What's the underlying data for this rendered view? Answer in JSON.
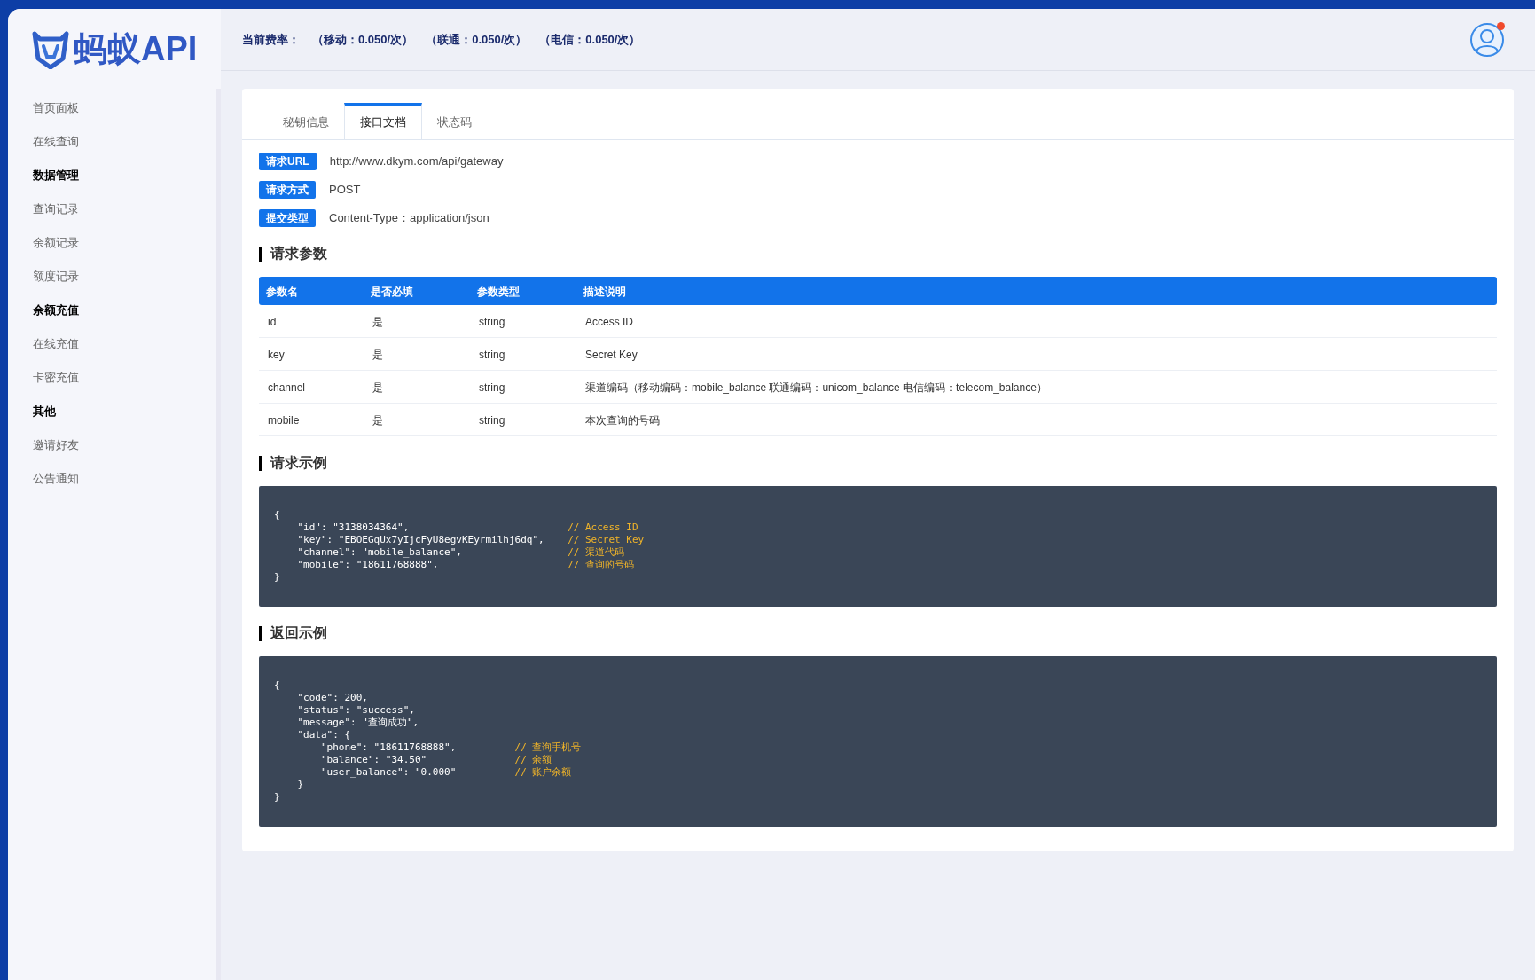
{
  "brand": {
    "name": "蚂蚁API"
  },
  "sidebar": [
    {
      "kind": "link",
      "label": "首页面板"
    },
    {
      "kind": "link",
      "label": "在线查询"
    },
    {
      "kind": "header",
      "label": "数据管理"
    },
    {
      "kind": "link",
      "label": "查询记录"
    },
    {
      "kind": "link",
      "label": "余额记录"
    },
    {
      "kind": "link",
      "label": "额度记录"
    },
    {
      "kind": "header",
      "label": "余额充值"
    },
    {
      "kind": "link",
      "label": "在线充值"
    },
    {
      "kind": "link",
      "label": "卡密充值"
    },
    {
      "kind": "header",
      "label": "其他"
    },
    {
      "kind": "link",
      "label": "邀请好友"
    },
    {
      "kind": "link",
      "label": "公告通知"
    }
  ],
  "header": {
    "rate_label": "当前费率：",
    "rates": [
      "（移动：0.050/次）",
      "（联通：0.050/次）",
      "（电信：0.050/次）"
    ],
    "notification": true
  },
  "tabs": [
    {
      "label": "秘钥信息",
      "selected": false
    },
    {
      "label": "接口文档",
      "selected": true
    },
    {
      "label": "状态码",
      "selected": false
    }
  ],
  "info": [
    {
      "tag": "请求URL",
      "value": "http://www.dkym.com/api/gateway"
    },
    {
      "tag": "请求方式",
      "value": "POST"
    },
    {
      "tag": "提交类型",
      "value": "Content-Type：application/json"
    }
  ],
  "params_title": "请求参数",
  "table": {
    "columns": [
      "参数名",
      "是否必填",
      "参数类型",
      "描述说明"
    ],
    "rows": [
      [
        "id",
        "是",
        "string",
        "Access ID"
      ],
      [
        "key",
        "是",
        "string",
        "Secret Key"
      ],
      [
        "channel",
        "是",
        "string",
        "渠道编码（移动编码：mobile_balance 联通编码：unicom_balance 电信编码：telecom_balance）"
      ],
      [
        "mobile",
        "是",
        "string",
        "本次查询的号码"
      ]
    ]
  },
  "code_blocks": [
    {
      "title": "请求示例",
      "lines": [
        {
          "code": "{"
        },
        {
          "code": "    \"id\": \"3138034364\",",
          "comment": "// Access ID"
        },
        {
          "code": "    \"key\": \"EBOEGqUx7yIjcFyU8egvKEyrmilhj6dq\",",
          "comment": "// Secret Key"
        },
        {
          "code": "    \"channel\": \"mobile_balance\",",
          "comment": "// 渠道代码"
        },
        {
          "code": "    \"mobile\": \"18611768888\",",
          "comment": "// 查询的号码"
        },
        {
          "code": "}"
        }
      ]
    },
    {
      "title": "返回示例",
      "lines": [
        {
          "code": "{"
        },
        {
          "code": "    \"code\": 200,"
        },
        {
          "code": "    \"status\": \"success\","
        },
        {
          "code": "    \"message\": \"查询成功\","
        },
        {
          "code": "    \"data\": {"
        },
        {
          "code": "        \"phone\": \"18611768888\",",
          "comment": "// 查询手机号"
        },
        {
          "code": "        \"balance\": \"34.50\"",
          "comment": "// 余额"
        },
        {
          "code": "        \"user_balance\": \"0.000\"",
          "comment": "// 账户余额"
        },
        {
          "code": "    }"
        },
        {
          "code": "}"
        }
      ]
    }
  ]
}
